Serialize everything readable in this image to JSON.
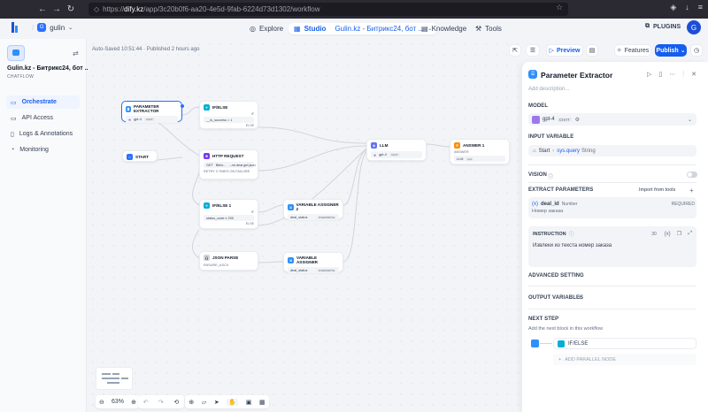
{
  "browser": {
    "url_prefix": "https://",
    "url_host": "dify.kz",
    "url_path": "/app/3c20b0f6-aa20-4e5d-9fab-6224d73d1302/workflow"
  },
  "header": {
    "workspace_initial": "G",
    "workspace_name": "gulin",
    "nav": {
      "explore": "Explore",
      "studio": "Studio",
      "app_name": "Gulin.kz - Битрикс24, бот ...",
      "knowledge": "Knowledge",
      "tools": "Tools"
    },
    "plugins": "PLUGINS",
    "user_initial": "G"
  },
  "sidebar": {
    "app_title": "Gulin.kz - Битрикс24, бот ...",
    "app_type": "CHATFLOW",
    "items": [
      {
        "label": "Orchestrate"
      },
      {
        "label": "API Access"
      },
      {
        "label": "Logs & Annotations"
      },
      {
        "label": "Monitoring"
      }
    ]
  },
  "canvas": {
    "autosave": "Auto-Saved 10:51:44 · Published 2 hours ago",
    "nodes": {
      "param_extractor": {
        "title": "PARAMETER EXTRACTOR",
        "model": "gpt-4",
        "chip": "CHAT"
      },
      "ifelse": {
        "title": "IF/ELSE",
        "if_label": "IF",
        "cond": "__is_success = 1",
        "else_label": "ELSE"
      },
      "start": {
        "title": "START"
      },
      "http": {
        "title": "HTTP REQUEST",
        "method": "GET",
        "url": "...rm.deal.get.json",
        "url_prefix": "​Bitrix...",
        "retry": "RETRY 3 TIMES ON FAILURE"
      },
      "llm": {
        "title": "LLM",
        "model": "gpt-4",
        "chip": "CHAT"
      },
      "answer": {
        "title": "ANSWER 1",
        "label": "ANSWER",
        "value": "LLM",
        "chip": "text"
      },
      "ifelse1": {
        "title": "IF/ELSE 1",
        "if_label": "IF",
        "cond": "status_code ≠ 200",
        "else_label": "ELSE"
      },
      "va2": {
        "title": "VARIABLE ASSIGNER 2",
        "var": "deal_status",
        "chip": "OVERWRITE"
      },
      "json": {
        "title": "JSON PARSE",
        "field": "ENSURE_ASCII"
      },
      "va": {
        "title": "VARIABLE ASSIGNER",
        "var": "deal_status",
        "chip": "OVERWRITE"
      }
    },
    "zoom": "63%"
  },
  "topbar": {
    "preview": "Preview",
    "features": "Features",
    "publish": "Publish"
  },
  "panel": {
    "title": "Parameter Extractor",
    "desc_placeholder": "Add description...",
    "model_label": "MODEL",
    "model_name": "gpt-4",
    "model_chip": "CHAT",
    "input_label": "INPUT VARIABLE",
    "input_source": "Start",
    "input_var": "sys.query",
    "input_type": "String",
    "vision_label": "VISION",
    "extract_label": "EXTRACT PARAMETERS",
    "import_label": "Import from tools",
    "param": {
      "prefix": "(x)",
      "name": "deal_id",
      "type": "Number",
      "required": "REQUIRED",
      "desc": "Номер заказа"
    },
    "instruction_label": "INSTRUCTION",
    "instruction_count": "30",
    "instruction_text": "Извлеки из текста номер заказа",
    "advanced_label": "ADVANCED SETTING",
    "output_label": "OUTPUT VARIABLES",
    "nextstep_label": "NEXT STEP",
    "nextstep_desc": "Add the next block in this workflow",
    "next_node": "IF/ELSE",
    "add_parallel": "ADD PARALLEL NODE"
  },
  "colors": {
    "accent": "#155eef",
    "llm": "#9e77ed",
    "ifelse": "#06aed4",
    "http": "#7839ee",
    "answer": "#f79009",
    "start": "#2970ff",
    "assigner": "#2e90fa"
  }
}
